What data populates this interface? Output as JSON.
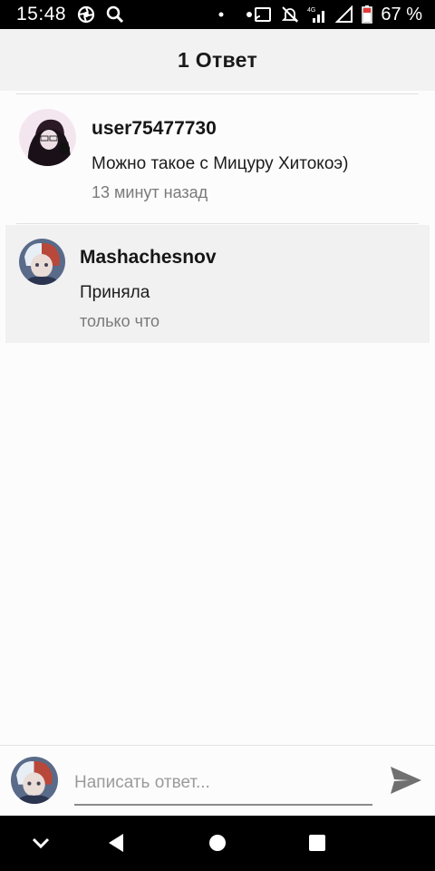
{
  "status_bar": {
    "time": "15:48",
    "network_label": "4G",
    "battery_percent": "67 %",
    "icons": [
      "aperture-icon",
      "search-icon",
      "dot-icon",
      "cast-icon",
      "mute-icon",
      "signal-icon",
      "wifi-empty-icon",
      "battery-icon"
    ]
  },
  "header": {
    "title": "1 Ответ"
  },
  "comments": [
    {
      "username": "user75477730",
      "text": "Можно такое с Мицуру Хитокоэ)",
      "time": "13 минут назад",
      "highlighted": false
    },
    {
      "username": "Mashachesnov",
      "text": "Приняла",
      "time": "только что",
      "highlighted": true
    }
  ],
  "reply": {
    "placeholder": "Написать ответ...",
    "send_icon": "send-icon"
  },
  "nav_bar": {
    "buttons": [
      "chevron-down-icon",
      "back-icon",
      "home-icon",
      "recents-icon"
    ]
  },
  "colors": {
    "highlight": "#f2f1f2",
    "header_bg": "#f3f2f3",
    "send_icon": "#707070"
  }
}
